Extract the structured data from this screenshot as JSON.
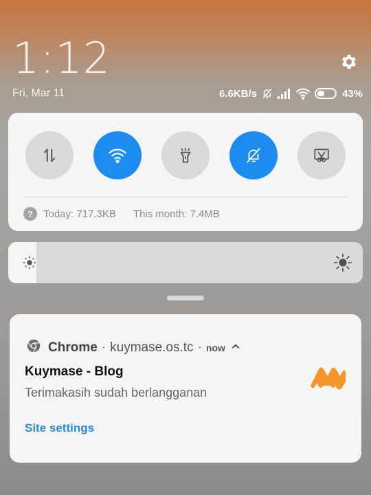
{
  "status": {
    "time": "1:12",
    "date": "Fri, Mar 11",
    "net_speed": "6.6KB/s",
    "battery_percent": "43%",
    "battery_level": 0.43
  },
  "quick_settings": {
    "tiles": [
      {
        "name": "mobile-data-tile",
        "icon": "data-arrows-icon",
        "active": false
      },
      {
        "name": "wifi-tile",
        "icon": "wifi-icon",
        "active": true
      },
      {
        "name": "flashlight-tile",
        "icon": "flashlight-icon",
        "active": false
      },
      {
        "name": "silent-tile",
        "icon": "bell-off-icon",
        "active": true
      },
      {
        "name": "screenshot-tile",
        "icon": "scissors-icon",
        "active": false
      }
    ],
    "usage_today": "Today: 717.3KB",
    "usage_month": "This month: 7.4MB",
    "help_glyph": "?"
  },
  "brightness": {
    "level": 0.08
  },
  "notification": {
    "app": "Chrome",
    "source": "kuymase.os.tc",
    "separator": "·",
    "time": "now",
    "title": "Kuymase - Blog",
    "body": "Terimakasih sudah berlangganan",
    "action": "Site settings"
  },
  "colors": {
    "accent": "#1d8cf0",
    "link": "#2b8ad8",
    "logo": "#f5952a"
  }
}
